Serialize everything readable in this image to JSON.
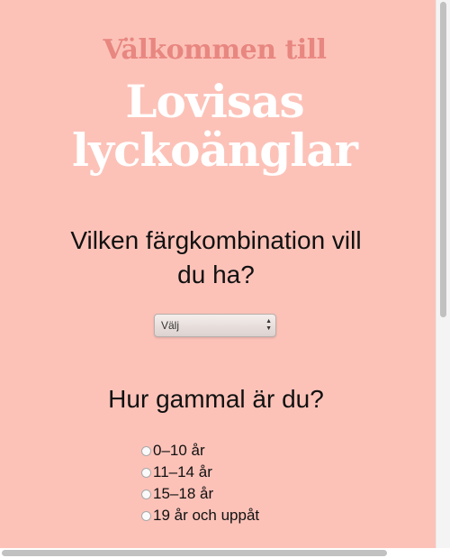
{
  "header": {
    "welcome": "Välkommen till",
    "brand_line1": "Lovisas",
    "brand_line2": "lyckoänglar"
  },
  "color_question": {
    "label_line1": "Vilken färgkombination vill",
    "label_line2": "du ha?",
    "select_value": "Välj"
  },
  "age_question": {
    "label": "Hur gammal är du?",
    "options": [
      "0–10 år",
      "11–14 år",
      "15–18 år",
      "19 år och uppåt"
    ]
  }
}
